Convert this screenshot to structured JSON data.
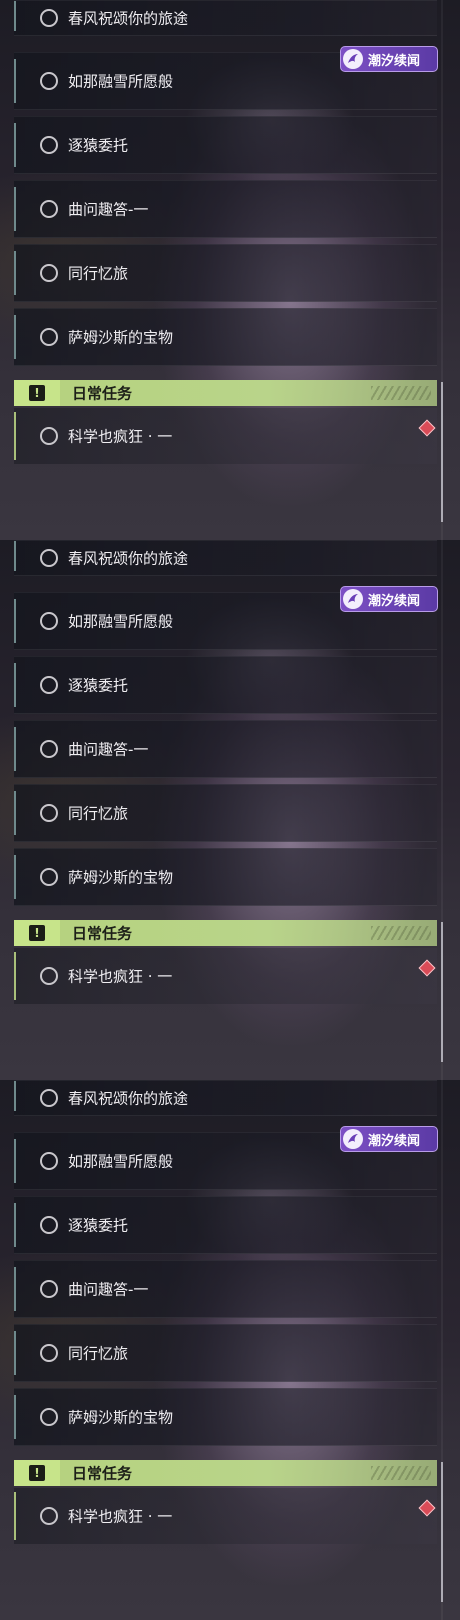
{
  "badge": {
    "text": "潮汐续闻"
  },
  "tasks": [
    {
      "label": "春风祝颂你的旅途"
    },
    {
      "label": "如那融雪所愿般"
    },
    {
      "label": "逐猿委托"
    },
    {
      "label": "曲问趣答-一"
    },
    {
      "label": "同行忆旅"
    },
    {
      "label": "萨姆沙斯的宝物"
    }
  ],
  "daily": {
    "title": "日常任务",
    "icon_glyph": "!",
    "task": {
      "label": "科学也疯狂 · 一"
    }
  },
  "colors": {
    "accent_green": "#b9d48a",
    "badge_purple": "#7c4fc4",
    "marker_red": "#d94b57"
  }
}
